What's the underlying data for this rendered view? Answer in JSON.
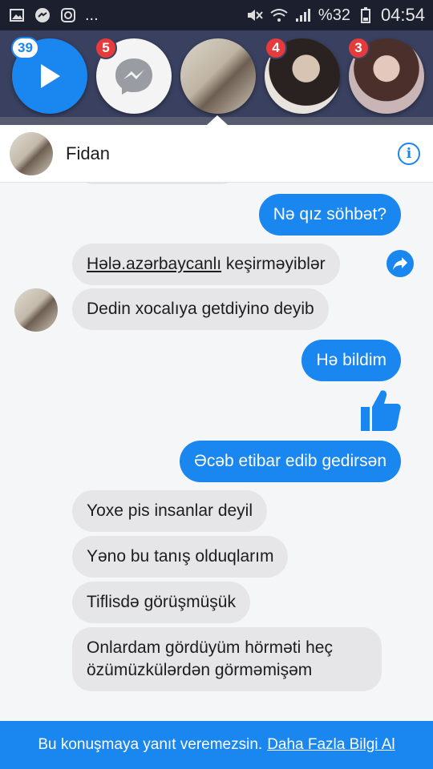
{
  "status_bar": {
    "battery": "%32",
    "time": "04:54",
    "more": "..."
  },
  "chat_heads": {
    "play_badge": "39",
    "messenger_badge": "5",
    "contact2_badge": "4",
    "contact3_badge": "3"
  },
  "chat": {
    "contact_name": "Fidan",
    "info_icon": "i"
  },
  "messages": {
    "m1": "Nə qız söhbət?",
    "m2_link": "Hələ.azərbaycanlı",
    "m2_rest": " keşirməyiblər",
    "m3": "Dedin xocalıya getdiyino deyib",
    "m4": "Hə bildim",
    "m5": "Əcəb etibar edib gedirsən",
    "m6": "Yoxe pis insanlar deyil",
    "m7": "Yəno bu tanış olduqlarım",
    "m8": "Tiflisdə görüşmüşük",
    "m9": "Onlardam gördüyüm hörməti heç özümüzkülərdən görməmişəm"
  },
  "footer": {
    "text": "Bu konuşmaya yanıt veremezsin.",
    "link": "Daha Fazla Bilgi Al"
  },
  "colors": {
    "accent": "#1a86f0",
    "badge": "#e53b3b",
    "incoming_bubble": "#e6e6e9"
  }
}
